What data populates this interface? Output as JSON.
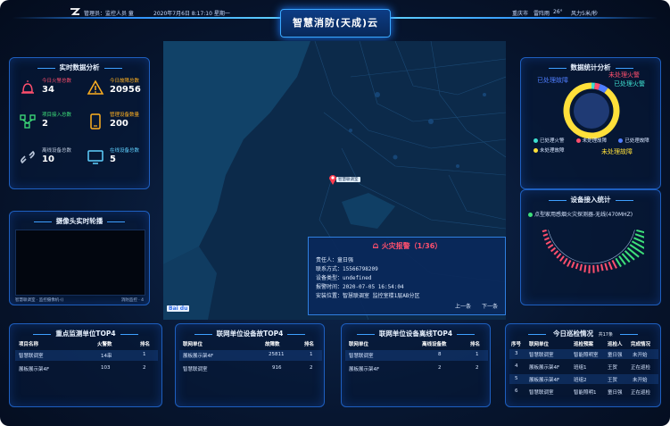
{
  "header": {
    "admin_label": "管理员：",
    "admin_name": "监控人员 童",
    "datetime": "2020年7月6日 8:17:10 星期一",
    "title": "智慧消防(天成)云",
    "weather_city": "重庆市",
    "weather_text": "雷阵雨",
    "temperature": "26°",
    "wind": "风力5米/秒"
  },
  "realtime": {
    "title": "实时数据分析",
    "stats": [
      {
        "label": "今日火警总数",
        "value": "34",
        "icon": "fire-alarm-icon",
        "color": "#ff4f6d"
      },
      {
        "label": "今日故障总数",
        "value": "20956",
        "icon": "warning-triangle-icon",
        "color": "#ffb020"
      },
      {
        "label": "项目接入总数",
        "value": "2",
        "icon": "network-nodes-icon",
        "color": "#3ee07a"
      },
      {
        "label": "管理设备数量",
        "value": "200",
        "icon": "phone-device-icon",
        "color": "#ffb020"
      },
      {
        "label": "离线设备总数",
        "value": "10",
        "icon": "link-broken-icon",
        "color": "#bcc8dc"
      },
      {
        "label": "在线设备总数",
        "value": "5",
        "icon": "monitor-online-icon",
        "color": "#5fd0ff"
      }
    ]
  },
  "camera": {
    "title": "摄像头实时轮播",
    "left_caption": "智慧联调室 · 监控摄像机-()",
    "right_caption": "消防监控 · 4"
  },
  "stats_analysis": {
    "title": "数据统计分析",
    "labels": [
      "已处理故障",
      "未处理火警",
      "已处理火警",
      "未处理故障"
    ],
    "legend": [
      {
        "name": "已处理火警",
        "color": "#3ee0d0"
      },
      {
        "name": "未处理故障",
        "color": "#ff4f6d"
      },
      {
        "name": "已处理故障",
        "color": "#4f7dff"
      },
      {
        "name": "未处理故障",
        "color": "#ffe03a"
      }
    ],
    "donut": [
      {
        "name": "已处理火警",
        "value": 2,
        "color": "#3ee0d0"
      },
      {
        "name": "未处理火警",
        "value": 3,
        "color": "#ff4f6d"
      },
      {
        "name": "已处理故障",
        "value": 5,
        "color": "#4f7dff"
      },
      {
        "name": "未处理故障",
        "value": 90,
        "color": "#ffe03a"
      }
    ]
  },
  "device_access": {
    "title": "设备接入统计",
    "legend_text": "点型家用感烟火灾探测器-无线(470MHZ)",
    "legend_color": "#3ee07a",
    "ring_values": [
      2,
      3,
      4,
      5,
      6,
      5,
      4,
      6,
      7,
      8,
      9,
      7,
      6,
      8,
      10,
      12,
      11,
      9,
      8,
      10,
      12,
      14,
      16,
      18,
      20,
      24,
      28,
      34,
      40,
      46,
      52,
      60
    ],
    "ring_color_low": "#ff4f6d",
    "ring_color_high": "#3ee07a"
  },
  "alarm": {
    "title": "火灾报警（1/36）",
    "rows": [
      "责任人：童日强",
      "联系方式：15566798209",
      "设备类型：undefined",
      "报警时间：2020-07-05 16:54:04",
      "安装位置：智慧联调室 监控室楼1层AB分区"
    ],
    "prev": "上一条",
    "next": "下一条",
    "marker_label": "智慧联调室"
  },
  "map": {
    "watermark": "Bai du"
  },
  "key_units": {
    "title": "重点监测单位TOP4",
    "headers": [
      "项目名称",
      "火警数",
      "排名"
    ],
    "rows": [
      [
        "智慧联调室",
        "14串",
        "1"
      ],
      [
        "展板展示架4F",
        "103",
        "2"
      ]
    ]
  },
  "fault_top": {
    "title": "联网单位设备故TOP4",
    "headers": [
      "联网单位",
      "故障数",
      "排名"
    ],
    "rows": [
      [
        "展板展示架4F",
        "25811",
        "1"
      ],
      [
        "智慧联调室",
        "916",
        "2"
      ]
    ]
  },
  "offline_top": {
    "title": "联网单位设备离线TOP4",
    "headers": [
      "联网单位",
      "离线设备数",
      "排名"
    ],
    "rows": [
      [
        "智慧联调室",
        "8",
        "1"
      ],
      [
        "展板展示架4F",
        "2",
        "2"
      ]
    ]
  },
  "inspection": {
    "title": "今日巡检情况",
    "count": "共17条",
    "headers": [
      "序号",
      "联网单位",
      "巡检预案",
      "巡检人",
      "完成情况"
    ],
    "rows": [
      [
        "3",
        "智慧联调室",
        "智能照明室",
        "童日强",
        "未开始"
      ],
      [
        "4",
        "展板展示架4F",
        "班组1",
        "王贺",
        "正在巡检"
      ],
      [
        "5",
        "展板展示架4F",
        "班组2",
        "王贺",
        "未开始"
      ],
      [
        "6",
        "智慧联调室",
        "智能照明1",
        "童日强",
        "正在巡检"
      ]
    ]
  }
}
